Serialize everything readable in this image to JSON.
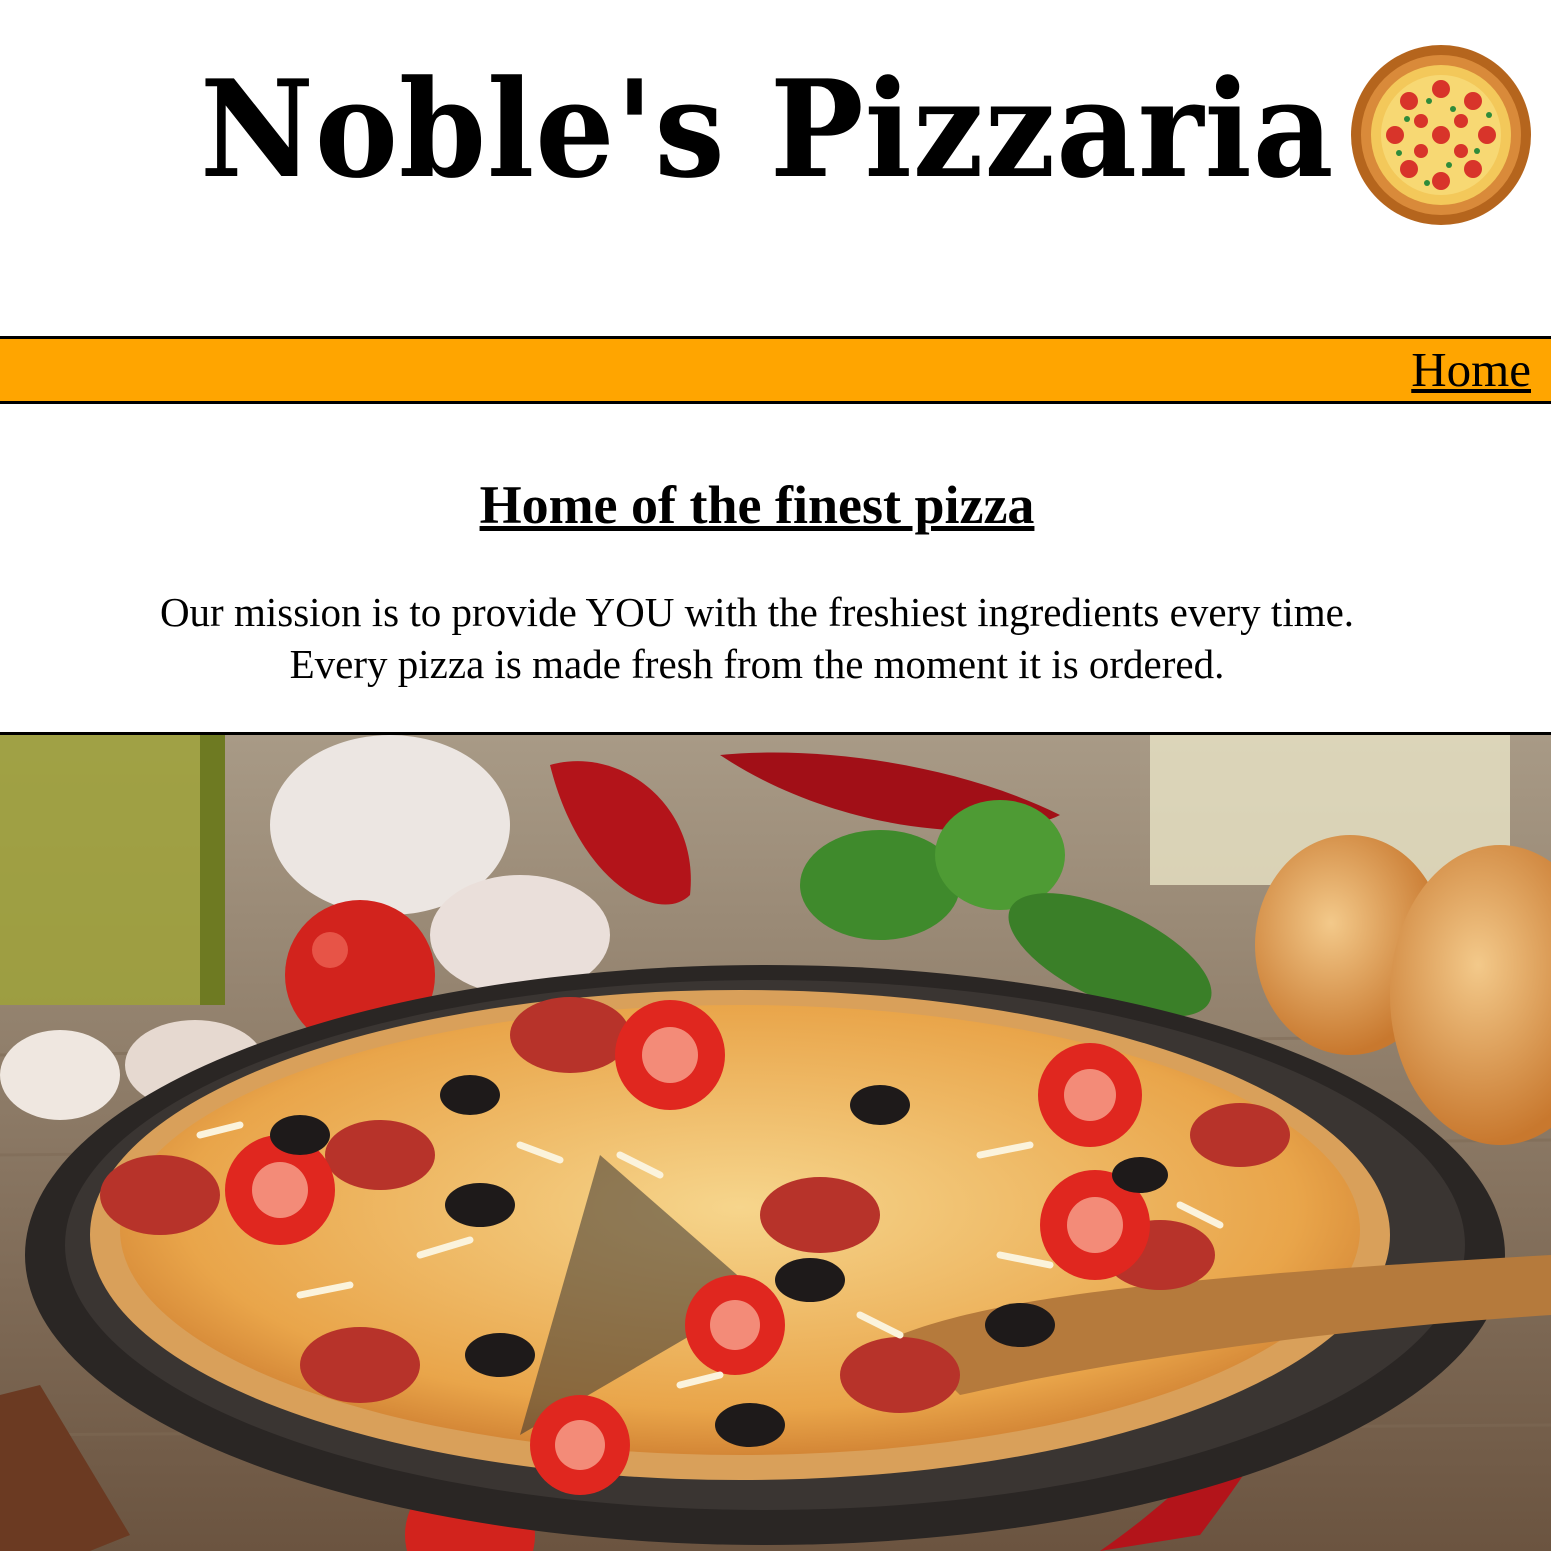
{
  "header": {
    "title": "Noble's Pizzaria",
    "logo_icon": "pizza-logo-icon"
  },
  "nav": {
    "links": [
      {
        "label": "Home"
      }
    ]
  },
  "main": {
    "headline": "Home of the finest pizza",
    "mission_line1": "Our mission is to provide YOU with the freshiest ingredients every time.",
    "mission_line2": "Every pizza is made fresh from the moment it is ordered.",
    "hero_image_icon": "pizza-hero-image"
  },
  "colors": {
    "nav_background": "#ffa500",
    "text": "#000000",
    "page_background": "#ffffff"
  }
}
